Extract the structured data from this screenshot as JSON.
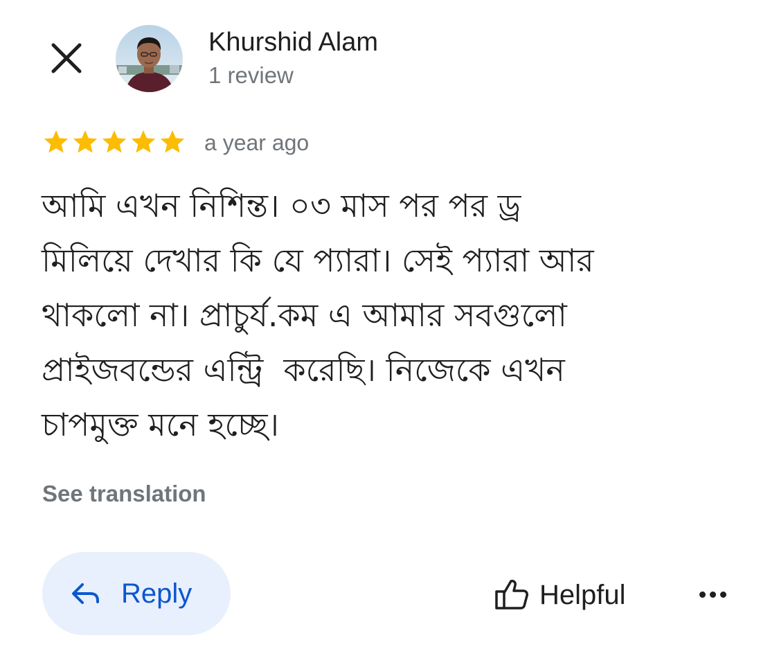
{
  "author": {
    "name": "Khurshid Alam",
    "reviews": "1 review"
  },
  "review": {
    "rating": 5,
    "max_rating": 5,
    "date": "a year ago",
    "text": "আমি এখন নিশিন্ত। ০৩ মাস পর পর ড্র\nমিলিয়ে দেখার কি যে প্যারা। সেই প্যারা আর\nথাকলো না। প্রাচুর্য.কম এ আমার সবগুলো\nপ্রাইজবন্ডের এন্ট্রি  করেছি। নিজেকে এখন\nচাপমুক্ত মনে হচ্ছে।",
    "translate_label": "See translation"
  },
  "actions": {
    "reply_label": "Reply",
    "helpful_label": "Helpful"
  },
  "icons": {
    "close": "close-icon",
    "star": "star-icon",
    "reply": "reply-arrow-icon",
    "helpful": "thumbs-up-icon",
    "more": "more-horizontal-icon"
  },
  "colors": {
    "star": "#fbbc04",
    "secondary_text": "#70757a",
    "reply_bg": "#e9f0fd",
    "reply_text": "#0b57d0",
    "primary_text": "#1f1f1f"
  }
}
